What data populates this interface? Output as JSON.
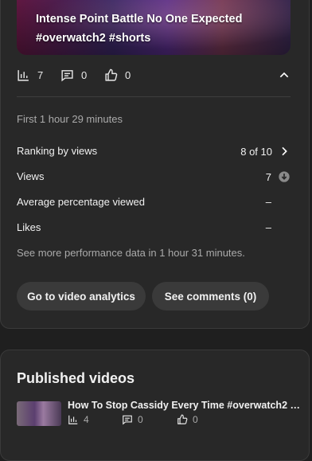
{
  "video": {
    "title_line1": "Intense Point Battle No One Expected",
    "title_line2": "#overwatch2 #shorts",
    "views": "7",
    "comments": "0",
    "likes": "0"
  },
  "performance": {
    "period": "First 1 hour 29 minutes",
    "ranking_label": "Ranking by views",
    "ranking_value": "8 of 10",
    "views_label": "Views",
    "views_value": "7",
    "avg_label": "Average percentage viewed",
    "avg_value": "–",
    "likes_label": "Likes",
    "likes_value": "–",
    "more_note": "See more performance data in 1 hour 31 minutes."
  },
  "buttons": {
    "analytics": "Go to video analytics",
    "comments": "See comments (0)"
  },
  "published": {
    "heading": "Published videos",
    "items": [
      {
        "title": "How To Stop Cassidy Every Time #overwatch2 …",
        "views": "4",
        "comments": "0",
        "likes": "0"
      }
    ]
  },
  "icons": {
    "views": "bar-chart-icon",
    "comments": "comment-icon",
    "likes": "thumbs-up-icon",
    "collapse": "chevron-up-icon",
    "next": "chevron-right-icon",
    "trend": "arrow-down-circle-icon"
  }
}
